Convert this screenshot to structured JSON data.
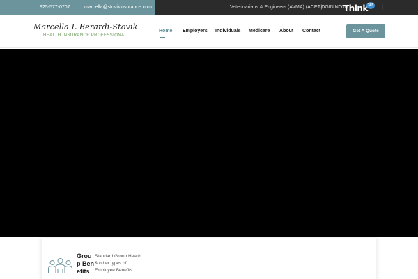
{
  "topbar": {
    "phone": "925-577-0707",
    "email": "marcella@stovikinsurance.com",
    "link_professionals": "Veterinarians & Engineers (AVMA) (ACEC)",
    "login": "LOGIN NOW!",
    "partner_logo": {
      "word": "Think",
      "badge": "365"
    },
    "separator": "|",
    "left_color": "#6c949c",
    "right_color": "#2b2b2b"
  },
  "header": {
    "logo_name": "Marcella L Berardi-Stovik",
    "logo_tagline": "HEALTH INSURANCE PROFESSIONAL",
    "nav": {
      "home": "Home",
      "employers": "Employers",
      "individuals": "Individuals",
      "medicare": "Medicare",
      "about": "About",
      "contact": "Contact"
    },
    "cta": "Get A Quote",
    "accent_color": "#5e8c95"
  },
  "hero": {
    "background": "#000000"
  },
  "services": {
    "card1": {
      "icon": "group-people-icon",
      "title": "Group Benefits",
      "description": "Standard Group Health & other types of Employee Benefits."
    }
  }
}
